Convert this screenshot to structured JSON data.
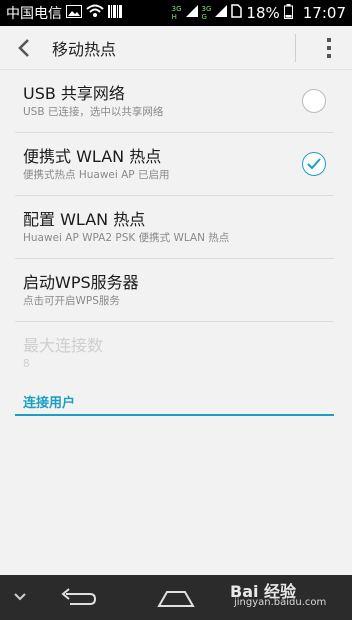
{
  "status_bar": {
    "carrier": "中国电信",
    "network_type_1": "3G",
    "network_type_2": "3G",
    "battery": "18%",
    "time": "17:07"
  },
  "header": {
    "title": "移动热点"
  },
  "settings": [
    {
      "title": "USB 共享网络",
      "subtitle": "USB 已连接，选中以共享网络",
      "checked": false
    },
    {
      "title": "便携式 WLAN 热点",
      "subtitle": "便携式热点 Huawei AP 已启用",
      "checked": true
    },
    {
      "title": "配置 WLAN 热点",
      "subtitle": "Huawei AP WPA2 PSK 便携式 WLAN 热点"
    },
    {
      "title": "启动WPS服务器",
      "subtitle": "点击可开启WPS服务"
    },
    {
      "title": "最大连接数",
      "subtitle": "8"
    }
  ],
  "section": {
    "label": "连接用户"
  },
  "watermark": {
    "brand": "Bai 经验",
    "url": "jingyan.baidu.com"
  },
  "colors": {
    "accent": "#1a9fc2",
    "status_bar": "#000000",
    "nav_bar": "#2b2b2b"
  }
}
